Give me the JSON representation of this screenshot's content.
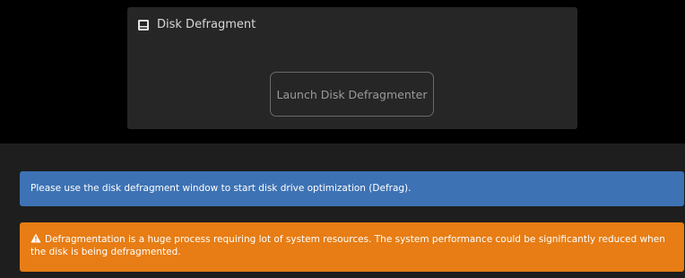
{
  "card": {
    "title": "Disk Defragment",
    "icon": "disk-icon",
    "button_label": "Launch Disk Defragmenter"
  },
  "alerts": {
    "info_text": "Please use the disk defragment window to start disk drive optimization (Defrag).",
    "info_color": "#3d72b4",
    "warning_text": "Defragmentation is a huge process requiring lot of system resources. The system performance could be significantly reduced when the disk is being defragmented.",
    "warning_icon": "warning-icon",
    "warning_color": "#e77d14"
  }
}
